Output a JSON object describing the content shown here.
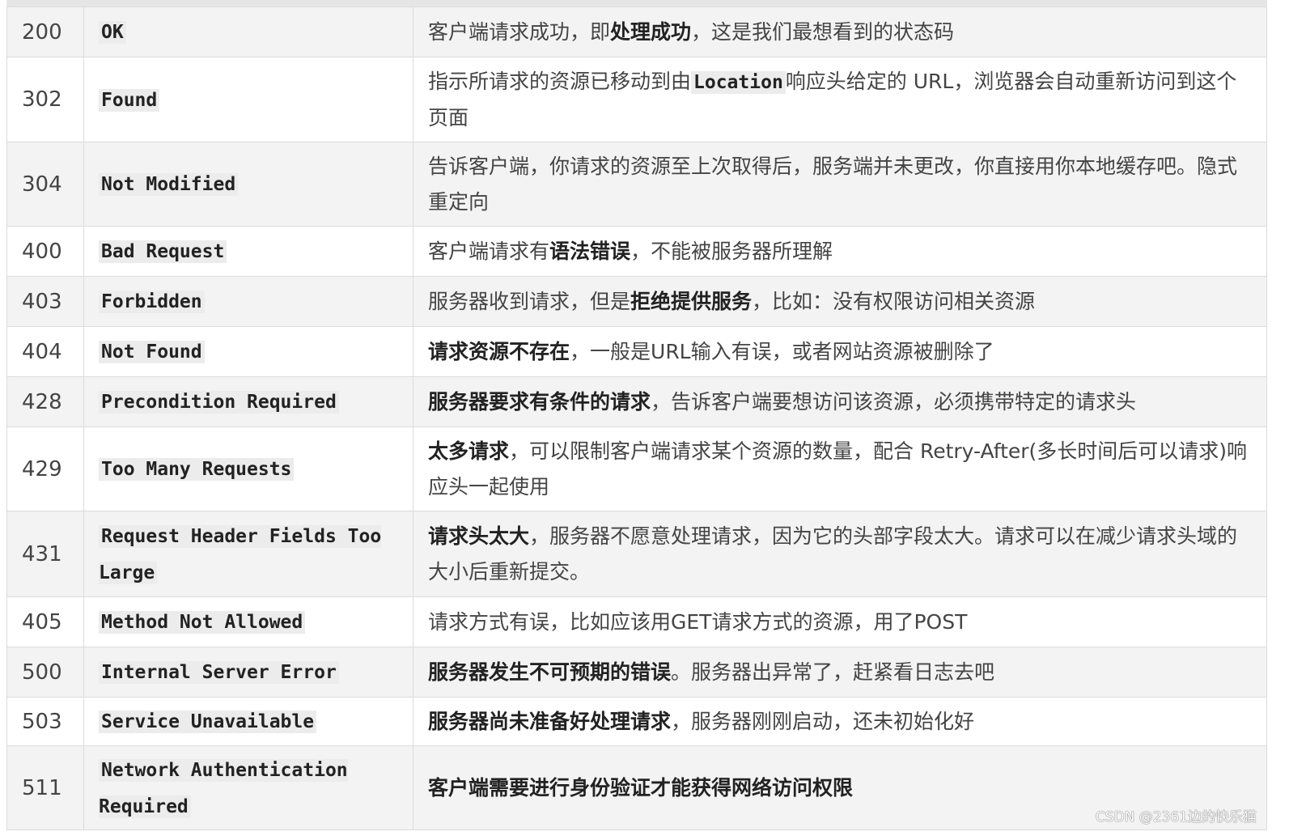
{
  "rows": [
    {
      "code": "200",
      "name": "OK",
      "h": 62,
      "desc": [
        {
          "t": "客户端请求成功，即"
        },
        {
          "t": "处理成功",
          "b": true
        },
        {
          "t": "，这是我们最想看到的状态码"
        }
      ]
    },
    {
      "code": "302",
      "name": "Found",
      "h": 105,
      "desc": [
        {
          "t": "指示所请求的资源已移动到由"
        },
        {
          "t": "Location",
          "m": true
        },
        {
          "t": "响应头给定的 URL，浏览器会自动重新访问到这个页面"
        }
      ]
    },
    {
      "code": "304",
      "name": "Not Modified",
      "h": 104,
      "desc": [
        {
          "t": "告诉客户端，你请求的资源至上次取得后，服务端并未更改，你直接用你本地缓存吧。隐式重定向"
        }
      ]
    },
    {
      "code": "400",
      "name": "Bad Request",
      "h": 62,
      "desc": [
        {
          "t": "客户端请求有"
        },
        {
          "t": "语法错误",
          "b": true
        },
        {
          "t": "，不能被服务器所理解"
        }
      ]
    },
    {
      "code": "403",
      "name": "Forbidden",
      "h": 62,
      "desc": [
        {
          "t": "服务器收到请求，但是"
        },
        {
          "t": "拒绝提供服务",
          "b": true
        },
        {
          "t": "，比如：没有权限访问相关资源"
        }
      ]
    },
    {
      "code": "404",
      "name": "Not Found",
      "h": 62,
      "desc": [
        {
          "t": "请求资源不存在",
          "b": true
        },
        {
          "t": "，一般是URL输入有误，或者网站资源被删除了"
        }
      ]
    },
    {
      "code": "428",
      "name": "Precondition Required",
      "h": 62,
      "desc": [
        {
          "t": "服务器要求有条件的请求",
          "b": true
        },
        {
          "t": "，告诉客户端要想访问该资源，必须携带特定的请求头"
        }
      ]
    },
    {
      "code": "429",
      "name": "Too Many Requests",
      "h": 104,
      "desc": [
        {
          "t": "太多请求",
          "b": true
        },
        {
          "t": "，可以限制客户端请求某个资源的数量，配合 Retry-After(多长时间后可以请求)响应头一起使用"
        }
      ]
    },
    {
      "code": "431",
      "name": "Request Header Fields Too Large",
      "h": 106,
      "desc": [
        {
          "t": "请求头太大",
          "b": true
        },
        {
          "t": "，服务器不愿意处理请求，因为它的头部字段太大。请求可以在减少请求头域的大小后重新提交。"
        }
      ]
    },
    {
      "code": "405",
      "name": "Method Not Allowed",
      "h": 62,
      "desc": [
        {
          "t": "请求方式有误，比如应该用GET请求方式的资源，用了POST"
        }
      ]
    },
    {
      "code": "500",
      "name": "Internal Server Error",
      "h": 62,
      "desc": [
        {
          "t": "服务器发生不可预期的错误",
          "b": true
        },
        {
          "t": "。服务器出异常了，赶紧看日志去吧"
        }
      ]
    },
    {
      "code": "503",
      "name": "Service Unavailable",
      "h": 60,
      "desc": [
        {
          "t": "服务器尚未准备好处理请求",
          "b": true
        },
        {
          "t": "，服务器刚刚启动，还未初始化好"
        }
      ]
    },
    {
      "code": "511",
      "name": "Network Authentication Required",
      "h": 104,
      "desc": [
        {
          "t": "客户端需要进行身份验证才能获得网络访问权限",
          "b": true
        }
      ]
    }
  ],
  "watermark": "CSDN @2361边的快乐猫"
}
